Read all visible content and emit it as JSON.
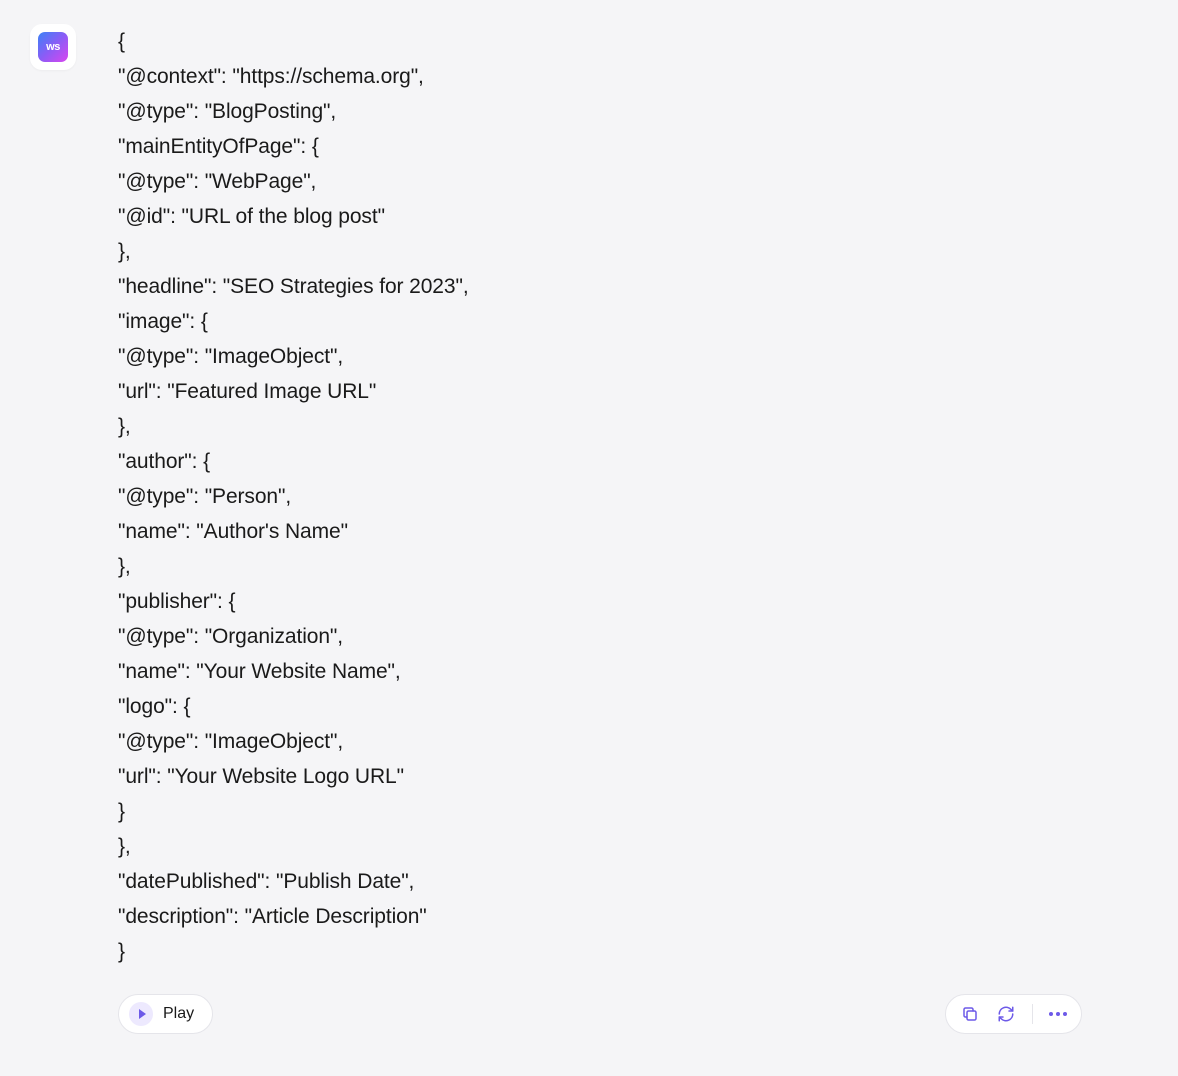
{
  "avatar": {
    "label": "ws"
  },
  "code_lines": [
    "{",
    "\"@context\": \"https://schema.org\",",
    "\"@type\": \"BlogPosting\",",
    "\"mainEntityOfPage\": {",
    "\"@type\": \"WebPage\",",
    "\"@id\": \"URL of the blog post\"",
    "},",
    "\"headline\": \"SEO Strategies for 2023\",",
    "\"image\": {",
    "\"@type\": \"ImageObject\",",
    "\"url\": \"Featured Image URL\"",
    "},",
    "\"author\": {",
    "\"@type\": \"Person\",",
    "\"name\": \"Author's Name\"",
    "},",
    "\"publisher\": {",
    "\"@type\": \"Organization\",",
    "\"name\": \"Your Website Name\",",
    "\"logo\": {",
    "\"@type\": \"ImageObject\",",
    "\"url\": \"Your Website Logo URL\"",
    "}",
    "},",
    "\"datePublished\": \"Publish Date\",",
    "\"description\": \"Article Description\"",
    "}"
  ],
  "toolbar": {
    "play_label": "Play"
  }
}
